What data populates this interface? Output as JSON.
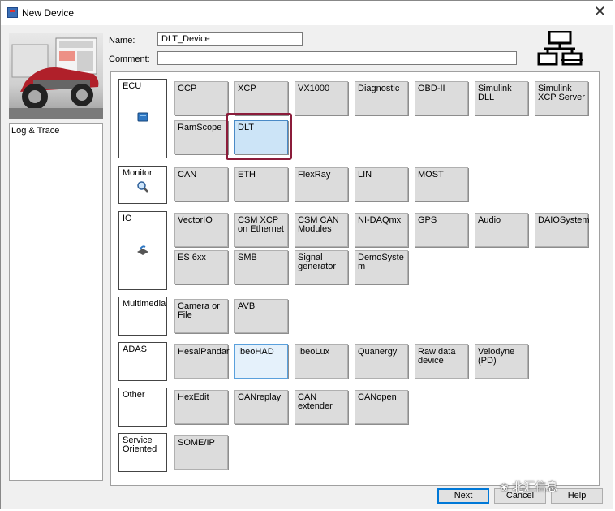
{
  "window": {
    "title": "New Device",
    "close": "✕"
  },
  "left_panel": {
    "items": [
      "Log & Trace"
    ]
  },
  "form": {
    "name_label": "Name:",
    "name_value": "DLT_Device",
    "comment_label": "Comment:",
    "comment_value": ""
  },
  "categories": [
    {
      "label": "ECU",
      "tiles": [
        {
          "label": "CCP"
        },
        {
          "label": "XCP"
        },
        {
          "label": "VX1000"
        },
        {
          "label": "Diagnostic"
        },
        {
          "label": "OBD-II"
        },
        {
          "label": "Simulink DLL"
        },
        {
          "label": "Simulink XCP Server"
        },
        {
          "label": "RamScope"
        },
        {
          "label": "DLT",
          "selected": true
        }
      ]
    },
    {
      "label": "Monitor",
      "tiles": [
        {
          "label": "CAN"
        },
        {
          "label": "ETH"
        },
        {
          "label": "FlexRay"
        },
        {
          "label": "LIN"
        },
        {
          "label": "MOST"
        }
      ]
    },
    {
      "label": "IO",
      "tiles": [
        {
          "label": "VectorIO"
        },
        {
          "label": "CSM XCP on Ethernet"
        },
        {
          "label": "CSM CAN Modules"
        },
        {
          "label": "NI-DAQmx"
        },
        {
          "label": "GPS"
        },
        {
          "label": "Audio"
        },
        {
          "label": "DAIOSystem"
        },
        {
          "label": "ES 6xx"
        },
        {
          "label": "SMB"
        },
        {
          "label": "Signal generator"
        },
        {
          "label": "DemoSystem"
        }
      ]
    },
    {
      "label": "Multimedia",
      "tiles": [
        {
          "label": "Camera or File"
        },
        {
          "label": "AVB"
        }
      ]
    },
    {
      "label": "ADAS",
      "tiles": [
        {
          "label": "HesaiPandar"
        },
        {
          "label": "IbeoHAD",
          "hover": true
        },
        {
          "label": "IbeoLux"
        },
        {
          "label": "Quanergy"
        },
        {
          "label": "Raw data device"
        },
        {
          "label": "Velodyne (PD)"
        }
      ]
    },
    {
      "label": "Other",
      "tiles": [
        {
          "label": "HexEdit"
        },
        {
          "label": "CANreplay"
        },
        {
          "label": "CAN extender"
        },
        {
          "label": "CANopen"
        }
      ]
    },
    {
      "label": "Service Oriented",
      "tiles": [
        {
          "label": "SOME/IP"
        }
      ]
    }
  ],
  "buttons": {
    "next": "Next",
    "cancel": "Cancel",
    "help": "Help"
  },
  "watermark": "北汇信息",
  "colors": {
    "selected_tile": "#cce4f7",
    "highlight_box": "#8b1c3a",
    "tile": "#dcdcdc"
  }
}
